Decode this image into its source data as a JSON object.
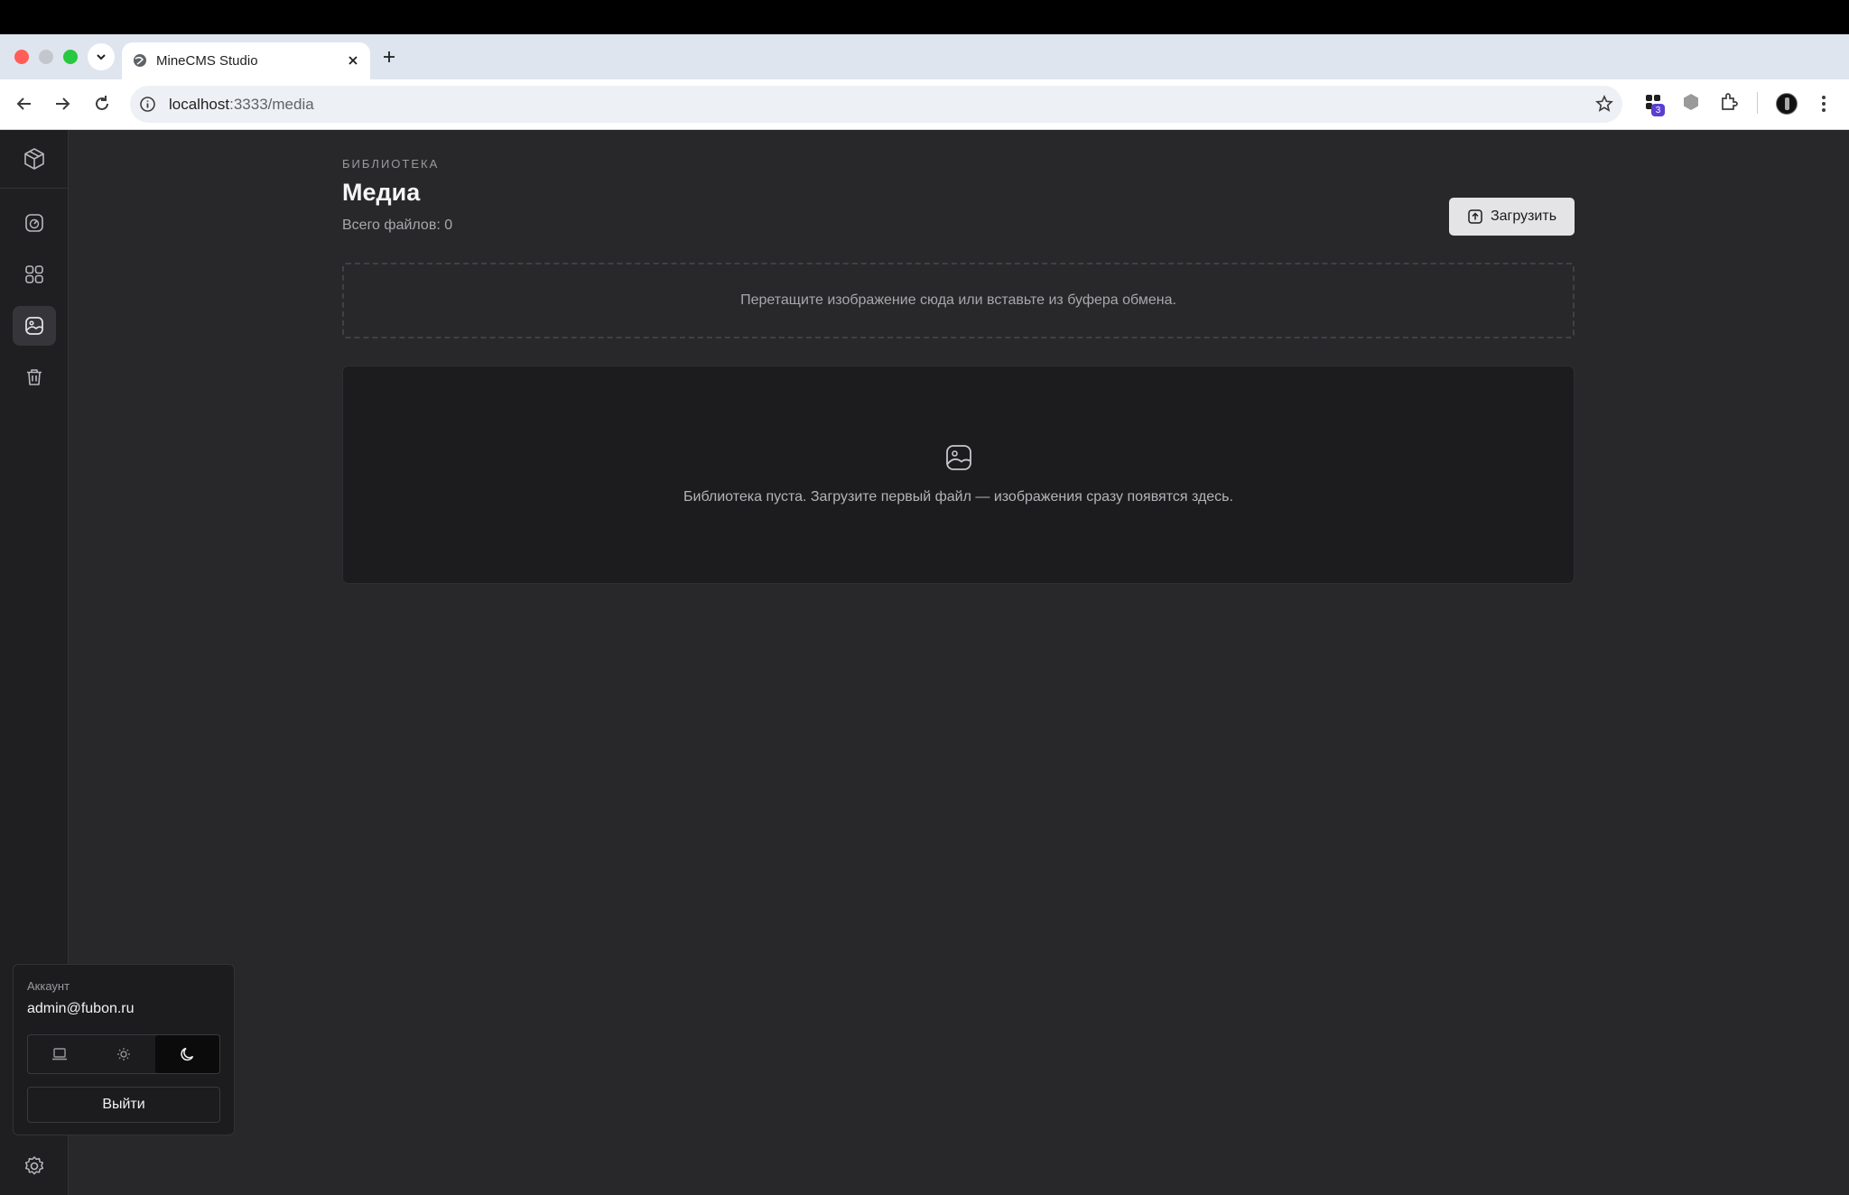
{
  "browser": {
    "tab_title": "MineCMS Studio",
    "url_host": "localhost",
    "url_path": ":3333/media",
    "extension_badge": "3"
  },
  "sidebar": {
    "items": [
      {
        "name": "logo",
        "icon": "cube-icon"
      },
      {
        "name": "dashboard",
        "icon": "gauge-icon"
      },
      {
        "name": "collections",
        "icon": "grid-icon"
      },
      {
        "name": "media",
        "icon": "image-icon",
        "active": true
      },
      {
        "name": "trash",
        "icon": "trash-icon"
      }
    ]
  },
  "account": {
    "label": "Аккаунт",
    "email": "admin@fubon.ru",
    "theme_options": [
      "system",
      "light",
      "dark"
    ],
    "theme_selected": "dark",
    "logout_label": "Выйти"
  },
  "main": {
    "eyebrow": "БИБЛИОТЕКА",
    "title": "Медиа",
    "file_count": "Всего файлов: 0",
    "upload_label": "Загрузить",
    "dropzone_text": "Перетащите изображение сюда или вставьте из буфера обмена.",
    "empty_text": "Библиотека пуста. Загрузите первый файл — изображения сразу появятся здесь."
  },
  "colors": {
    "background": "#28282b",
    "sidebar": "#1f1f22",
    "panel": "#1c1c1e",
    "upload_button": "#e4e4e6"
  }
}
